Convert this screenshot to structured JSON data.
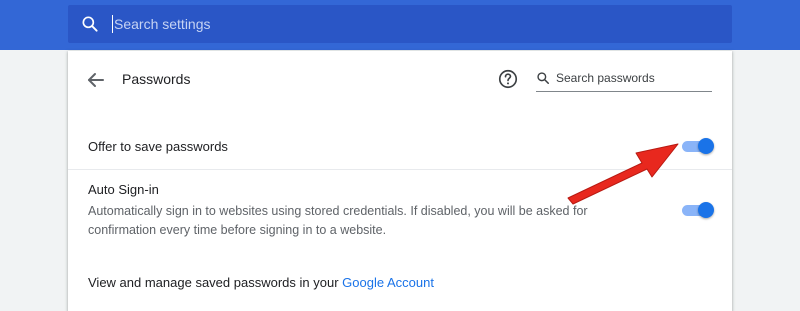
{
  "search": {
    "placeholder": "Search settings"
  },
  "header": {
    "title": "Passwords",
    "search_placeholder": "Search passwords"
  },
  "settings": {
    "offer_save": {
      "label": "Offer to save passwords",
      "enabled": true
    },
    "auto_signin": {
      "label": "Auto Sign-in",
      "description": "Automatically sign in to websites using stored credentials. If disabled, you will be asked for confirmation every time before signing in to a website.",
      "enabled": true
    },
    "manage": {
      "text": "View and manage saved passwords in your ",
      "link_text": "Google Account"
    }
  },
  "colors": {
    "topbar": "#3367d6",
    "search_field": "#2a56c6",
    "toggle_on": "#1a73e8",
    "toggle_track": "#8ab4f8",
    "link": "#1a73e8",
    "annotation_arrow": "#e8281e"
  },
  "icons": {
    "settings_search": "search-icon",
    "back": "arrow-back-icon",
    "help": "help-circle-icon",
    "password_search": "search-icon"
  }
}
